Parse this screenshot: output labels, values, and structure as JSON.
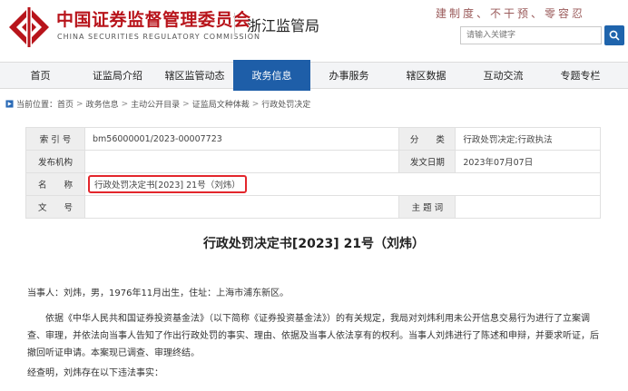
{
  "header": {
    "org_name_cn": "中国证券监督管理委员会",
    "org_name_en": "CHINA SECURITIES REGULATORY COMMISSION",
    "bureau": "浙江监管局",
    "slogan": "建制度、不干预、零容忍",
    "search_placeholder": "请输入关键字",
    "brand_color": "#b8141b"
  },
  "nav": {
    "active_color": "#1e5ea8",
    "items": [
      {
        "label": "首页"
      },
      {
        "label": "证监局介绍"
      },
      {
        "label": "辖区监管动态"
      },
      {
        "label": "政务信息"
      },
      {
        "label": "办事服务"
      },
      {
        "label": "辖区数据"
      },
      {
        "label": "互动交流"
      },
      {
        "label": "专题专栏"
      }
    ],
    "active_index": 3
  },
  "breadcrumb": {
    "prefix": "当前位置：",
    "items": [
      "首页",
      "政务信息",
      "主动公开目录",
      "证监局文种体裁",
      "行政处罚决定"
    ]
  },
  "info": {
    "index_label": "索 引 号",
    "index_value": "bm56000001/2023-00007723",
    "category_label": "分　　类",
    "category_value": "行政处罚决定;行政执法",
    "issuer_label": "发布机构",
    "issuer_value": "",
    "date_label": "发文日期",
    "date_value": "2023年07月07日",
    "name_label": "名　　称",
    "name_value": "行政处罚决定书[2023] 21号（刘炜）",
    "docno_label": "文　　号",
    "docno_value": "",
    "keywords_label": "主 题 词",
    "keywords_value": "",
    "highlight_color": "#e3262c"
  },
  "document": {
    "title": "行政处罚决定书[2023] 21号（刘炜）",
    "party": "当事人：刘炜，男，1976年11月出生，住址：上海市浦东新区。",
    "basis": "依据《中华人民共和国证券投资基金法》（以下简称《证券投资基金法》）的有关规定，我局对刘炜利用未公开信息交易行为进行了立案调查、审理，并依法向当事人告知了作出行政处罚的事实、理由、依据及当事人依法享有的权利。当事人刘炜进行了陈述和申辩，并要求听证，后撤回听证申请。本案现已调查、审理终结。",
    "facts_intro": "经查明，刘炜存在以下违法事实："
  }
}
